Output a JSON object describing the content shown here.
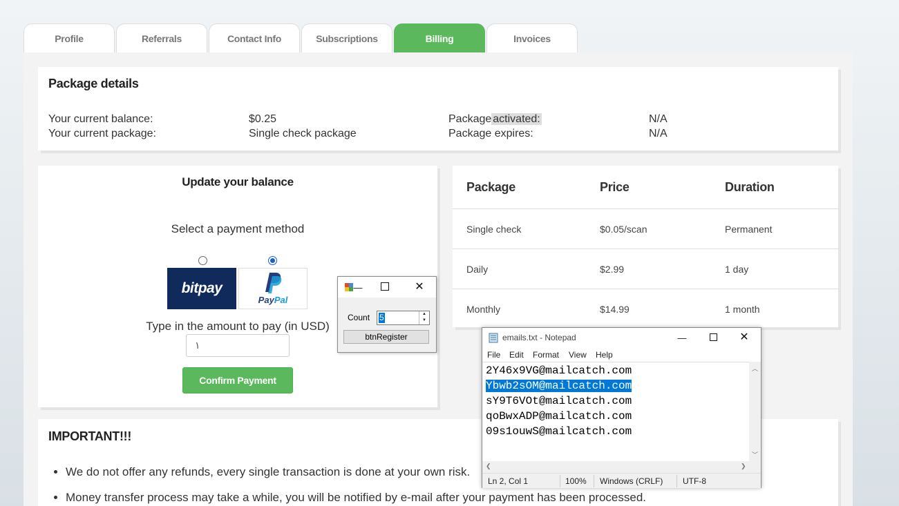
{
  "tabs": [
    {
      "label": "Profile",
      "active": false
    },
    {
      "label": "Referrals",
      "active": false
    },
    {
      "label": "Contact Info",
      "active": false
    },
    {
      "label": "Subscriptions",
      "active": false
    },
    {
      "label": "Billing",
      "active": true
    },
    {
      "label": "Invoices",
      "active": false
    }
  ],
  "package_details": {
    "title": "Package details",
    "balance_label": "Your current balance:",
    "balance_value": "$0.25",
    "package_label": "Your current package:",
    "package_value": "Single check package",
    "activated_label_a": "Package",
    "activated_label_b": "activated:",
    "activated_value": "N/A",
    "expires_label": "Package expires:",
    "expires_value": "N/A"
  },
  "balance": {
    "title": "Update your balance",
    "select_label": "Select a payment method",
    "methods": [
      {
        "name": "bitpay",
        "selected": false
      },
      {
        "name": "PayPal",
        "selected": true
      }
    ],
    "amount_label": "Type in the amount to pay (in USD)",
    "amount_value": "١",
    "confirm_label": "Confirm Payment"
  },
  "pricing": {
    "headers": [
      "Package",
      "Price",
      "Duration"
    ],
    "rows": [
      [
        "Single check",
        "$0.05/scan",
        "Permanent"
      ],
      [
        "Daily",
        "$2.99",
        "1 day"
      ],
      [
        "Monthly",
        "$14.99",
        "1 month"
      ]
    ]
  },
  "important": {
    "title": "IMPORTANT!!!",
    "items": [
      "We do not offer any refunds, every single transaction is done at your own risk.",
      "Money transfer process may take a while, you will be notified by e-mail after your payment has been processed."
    ]
  },
  "count_dialog": {
    "count_label": "Count",
    "count_value": "5",
    "register_label": "btnRegister"
  },
  "notepad": {
    "title": "emails.txt - Notepad",
    "menu": [
      "File",
      "Edit",
      "Format",
      "View",
      "Help"
    ],
    "lines": [
      "2Y46x9VG@mailcatch.com",
      "Ybwb2sOM@mailcatch.com",
      "sY9T6VOt@mailcatch.com",
      "qoBwxADP@mailcatch.com",
      "09s1ouwS@mailcatch.com"
    ],
    "selected_line": 1,
    "status": {
      "position": "Ln 2, Col 1",
      "zoom": "100%",
      "line_ending": "Windows (CRLF)",
      "encoding": "UTF-8"
    }
  },
  "colors": {
    "accent_green": "#5cb85c",
    "bitpay_navy": "#102a5b",
    "selection_blue": "#0078d7"
  }
}
